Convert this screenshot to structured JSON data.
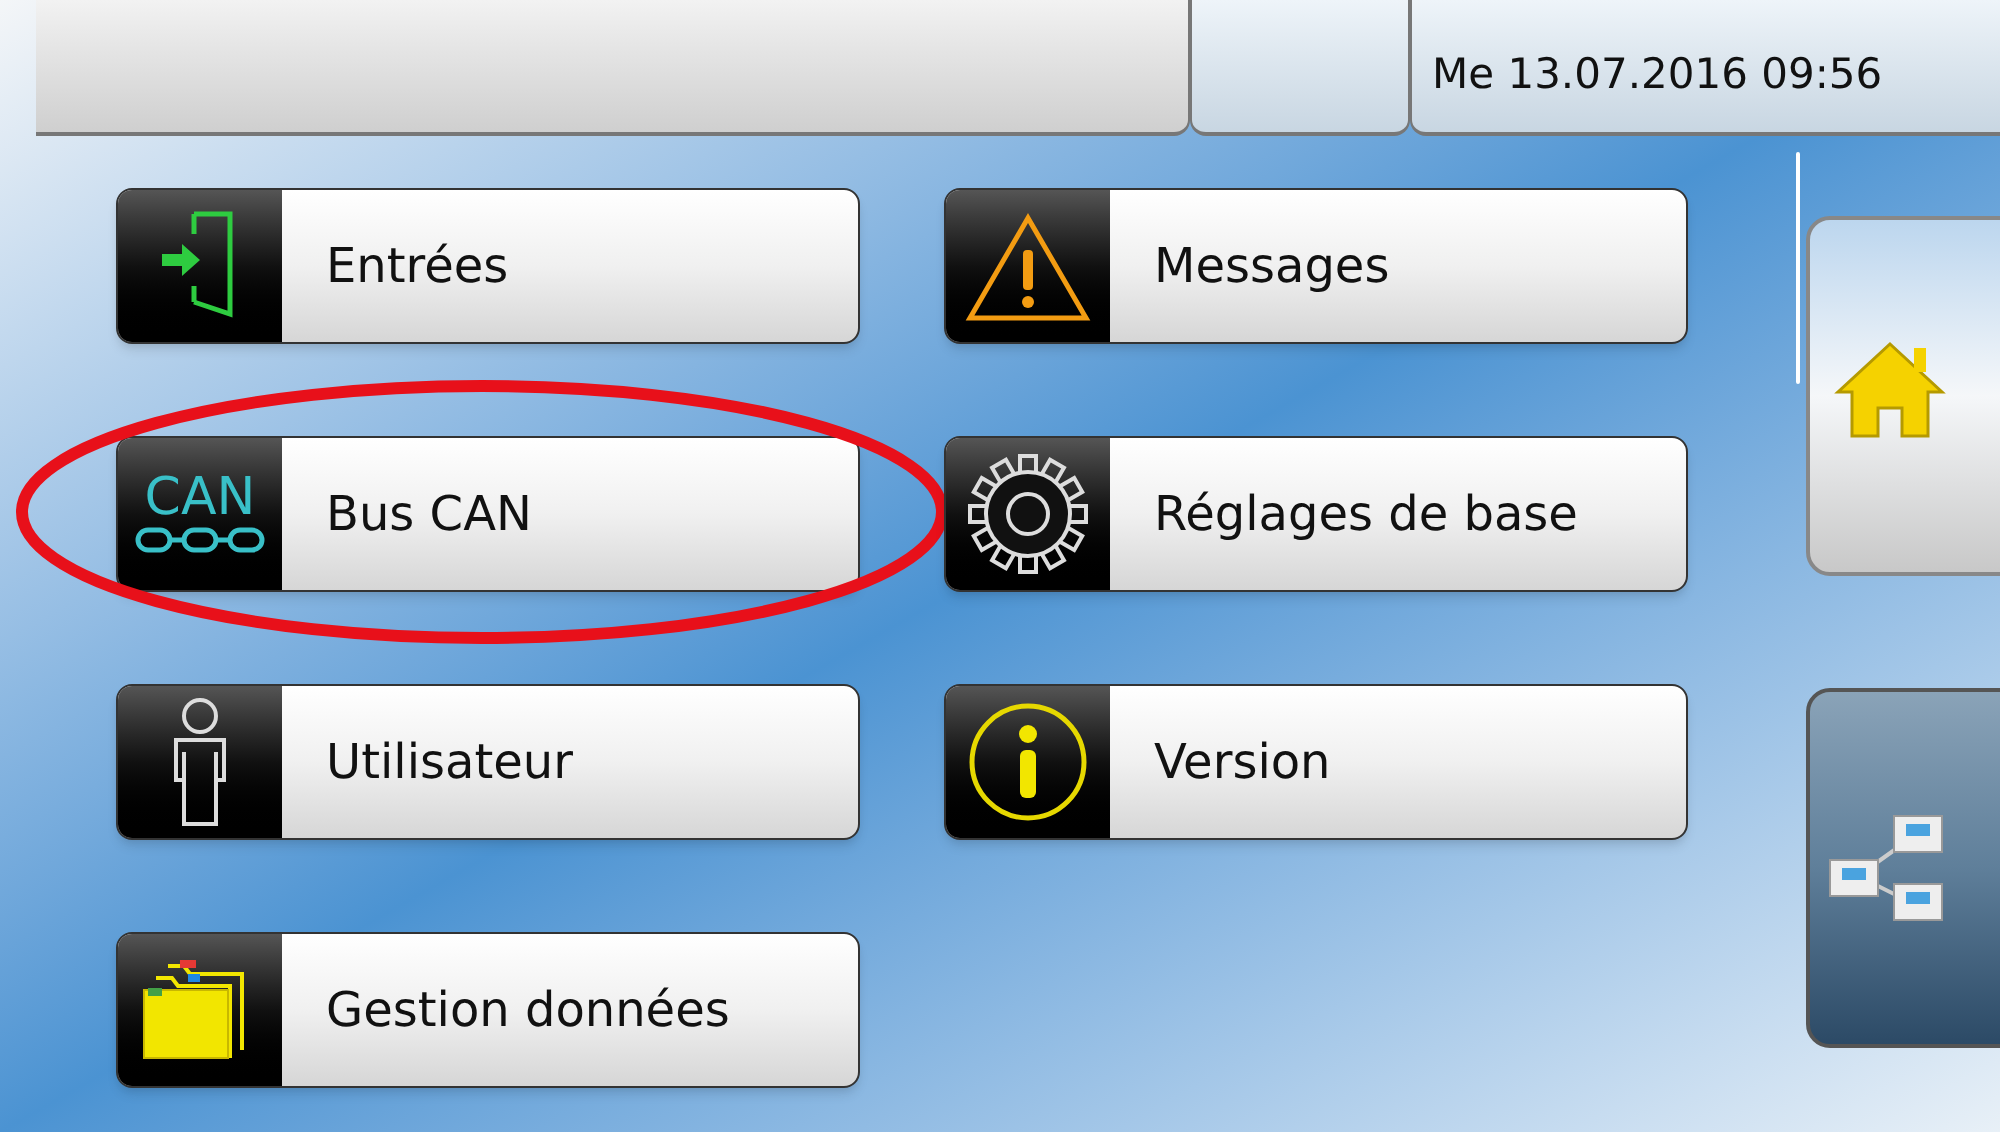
{
  "header": {
    "datetime": "Me 13.07.2016 09:56"
  },
  "menu_items": [
    {
      "label": "Entrées",
      "kind": "inputs"
    },
    {
      "label": "Messages",
      "kind": "warning"
    },
    {
      "label": "Bus CAN",
      "kind": "can",
      "icon_label": "CAN",
      "highlighted": true
    },
    {
      "label": "Réglages de base",
      "kind": "gear"
    },
    {
      "label": "Utilisateur",
      "kind": "user"
    },
    {
      "label": "Version",
      "kind": "info"
    },
    {
      "label": "Gestion données",
      "kind": "folder"
    }
  ],
  "side_buttons": [
    {
      "kind": "home"
    },
    {
      "kind": "network"
    }
  ]
}
